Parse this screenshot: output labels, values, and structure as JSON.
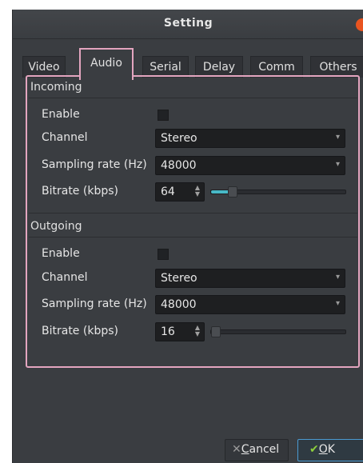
{
  "window": {
    "title": "Setting"
  },
  "tabs": [
    {
      "label": "Video"
    },
    {
      "label": "Audio",
      "active": true
    },
    {
      "label": "Serial"
    },
    {
      "label": "Delay"
    },
    {
      "label": "Comm"
    },
    {
      "label": "Others"
    }
  ],
  "incoming": {
    "header": "Incoming",
    "enable_label": "Enable",
    "enabled": false,
    "channel_label": "Channel",
    "channel_value": "Stereo",
    "sampling_label": "Sampling rate (Hz)",
    "sampling_value": "48000",
    "bitrate_label": "Bitrate (kbps)",
    "bitrate_value": "64",
    "bitrate_slider_fraction": 0.13
  },
  "outgoing": {
    "header": "Outgoing",
    "enable_label": "Enable",
    "enabled": false,
    "channel_label": "Channel",
    "channel_value": "Stereo",
    "sampling_label": "Sampling rate (Hz)",
    "sampling_value": "48000",
    "bitrate_label": "Bitrate (kbps)",
    "bitrate_value": "16",
    "bitrate_slider_fraction": 0.0
  },
  "buttons": {
    "cancel_label": "Cancel",
    "cancel_mnemonic": "C",
    "cancel_rest": "ancel",
    "ok_label": "OK",
    "ok_mnemonic": "O",
    "ok_rest": "K"
  },
  "colors": {
    "highlight_border": "#e3a5bf",
    "slider_fill": "#48b9c7",
    "close_button": "#e95420",
    "ok_check": "#8ecf3c"
  },
  "icons": {
    "close": "close-icon",
    "combo_arrow": "chevron-down-icon",
    "cancel": "x-icon",
    "ok": "checkmark-icon"
  }
}
